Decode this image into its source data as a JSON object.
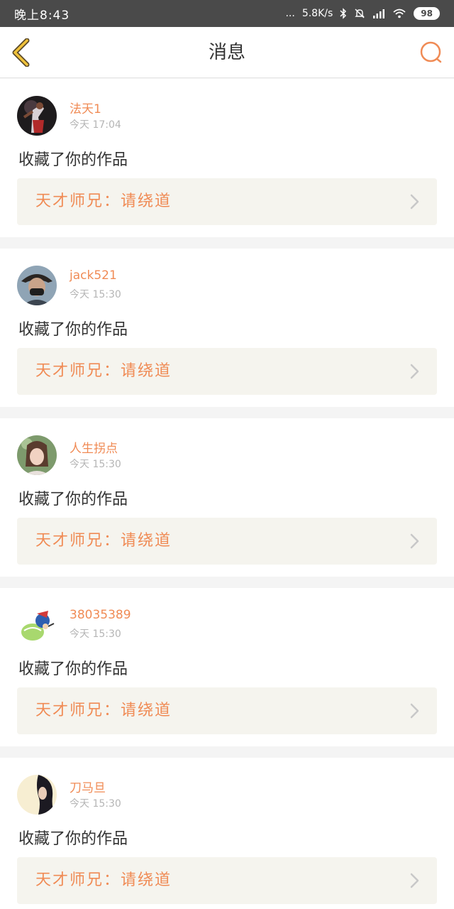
{
  "status_bar": {
    "time": "晚上8:43",
    "dots": "...",
    "speed": "5.8K/s",
    "battery": "98"
  },
  "nav": {
    "title": "消息"
  },
  "messages": [
    {
      "username": "法天1",
      "time": "今天 17:04",
      "action": "收藏了你的作品",
      "work_title": "天才师兄：请绕道"
    },
    {
      "username": "jack521",
      "time": "今天 15:30",
      "action": "收藏了你的作品",
      "work_title": "天才师兄：请绕道"
    },
    {
      "username": "人生拐点",
      "time": "今天 15:30",
      "action": "收藏了你的作品",
      "work_title": "天才师兄：请绕道"
    },
    {
      "username": "38035389",
      "time": "今天 15:30",
      "action": "收藏了你的作品",
      "work_title": "天才师兄：请绕道"
    },
    {
      "username": "刀马旦",
      "time": "今天 15:30",
      "action": "收藏了你的作品",
      "work_title": "天才师兄：请绕道"
    }
  ],
  "colors": {
    "accent": "#f08b55",
    "back_arrow": "#f0c23a",
    "status_bar": "#4a4a4a",
    "work_link_bg": "#f5f4ee"
  },
  "icons": {
    "back": "back-chevron-icon",
    "search": "search-icon",
    "signal": "signal-icon",
    "wifi": "wifi-icon",
    "bluetooth": "bluetooth-icon",
    "mute": "bell-off-icon",
    "row_arrow": "chevron-right-icon"
  }
}
